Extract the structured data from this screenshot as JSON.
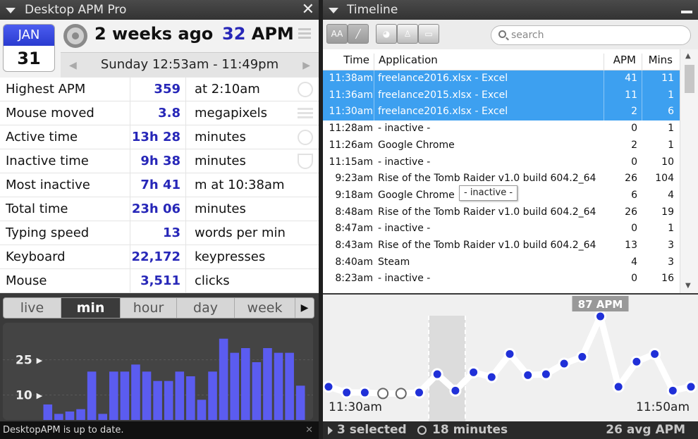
{
  "left_panel": {
    "title": "Desktop APM Pro",
    "close_label": "✕",
    "calendar": {
      "month": "JAN",
      "day": "31"
    },
    "ago": "2 weeks ago",
    "apm_value": "32",
    "apm_unit": "APM",
    "date_range": "Sunday 12:53am - 11:49pm",
    "stats": [
      {
        "label": "Highest APM",
        "value": "359",
        "unit": "at 2:10am"
      },
      {
        "label": "Mouse moved",
        "value": "3.8",
        "unit": "megapixels"
      },
      {
        "label": "Active time",
        "value": "13h 28",
        "unit": "minutes"
      },
      {
        "label": "Inactive time",
        "value": "9h 38",
        "unit": "minutes"
      },
      {
        "label": "Most inactive",
        "value": "7h 41",
        "unit": "m at 10:38am"
      },
      {
        "label": "Total time",
        "value": "23h 06",
        "unit": "minutes"
      },
      {
        "label": "Typing speed",
        "value": "13",
        "unit": "words per min"
      },
      {
        "label": "Keyboard",
        "value": "22,172",
        "unit": "keypresses"
      },
      {
        "label": "Mouse",
        "value": "3,511",
        "unit": "clicks"
      }
    ],
    "tabs": [
      "live",
      "min",
      "hour",
      "day",
      "week"
    ],
    "active_tab": "min",
    "status": "DesktopAPM is up to date.",
    "status_close": "✕"
  },
  "chart_data": {
    "type": "bar",
    "ytick_labels": [
      "25",
      "10"
    ],
    "ytick_values": [
      25,
      10
    ],
    "ylim": [
      0,
      36
    ],
    "values": [
      6,
      2,
      3,
      4,
      20,
      2,
      20,
      20,
      23,
      20,
      16,
      16,
      20,
      18,
      8,
      20,
      34,
      28,
      30,
      24,
      30,
      28,
      28,
      14
    ],
    "bar_color": "#5b5cf0",
    "grid": true
  },
  "right_panel": {
    "title": "Timeline",
    "toolbar_buttons": [
      "font-size-icon",
      "graph-icon",
      "pie-icon",
      "users-icon",
      "drive-icon"
    ],
    "search_placeholder": "search",
    "columns": {
      "time": "Time",
      "application": "Application",
      "apm": "APM",
      "mins": "Mins"
    },
    "rows": [
      {
        "time": "11:38am",
        "app": "freelance2016.xlsx - Excel",
        "apm": "41",
        "mins": "11",
        "selected": true
      },
      {
        "time": "11:36am",
        "app": "freelance2015.xlsx - Excel",
        "apm": "11",
        "mins": "1",
        "selected": true
      },
      {
        "time": "11:30am",
        "app": "freelance2016.xlsx - Excel",
        "apm": "2",
        "mins": "6",
        "selected": true
      },
      {
        "time": "11:28am",
        "app": "- inactive -",
        "apm": "0",
        "mins": "1",
        "selected": false
      },
      {
        "time": "11:26am",
        "app": "Google Chrome",
        "apm": "2",
        "mins": "1",
        "selected": false
      },
      {
        "time": "11:15am",
        "app": "- inactive -",
        "apm": "0",
        "mins": "10",
        "selected": false
      },
      {
        "time": "9:23am",
        "app": "Rise of the Tomb Raider v1.0 build 604.2_64",
        "apm": "26",
        "mins": "104",
        "selected": false
      },
      {
        "time": "9:18am",
        "app": "Google Chrome",
        "apm": "6",
        "mins": "4",
        "selected": false
      },
      {
        "time": "8:48am",
        "app": "Rise of the Tomb Raider v1.0 build 604.2_64",
        "apm": "26",
        "mins": "19",
        "selected": false
      },
      {
        "time": "8:47am",
        "app": "- inactive -",
        "apm": "0",
        "mins": "1",
        "selected": false
      },
      {
        "time": "8:43am",
        "app": "Rise of the Tomb Raider v1.0 build 604.2_64",
        "apm": "13",
        "mins": "3",
        "selected": false
      },
      {
        "time": "8:40am",
        "app": "Steam",
        "apm": "4",
        "mins": "3",
        "selected": false
      },
      {
        "time": "8:23am",
        "app": "- inactive -",
        "apm": "0",
        "mins": "16",
        "selected": false
      }
    ],
    "tooltip": "- inactive -",
    "timeline": {
      "peak_label": "87 APM",
      "start_label": "11:30am",
      "end_label": "11:50am",
      "values": [
        14,
        8,
        8,
        7,
        7,
        8,
        27,
        10,
        29,
        24,
        48,
        26,
        27,
        38,
        45,
        87,
        14,
        40,
        48,
        10,
        14
      ],
      "hollow_points": [
        3,
        4
      ],
      "ymax": 95
    },
    "status": {
      "selected": "3 selected",
      "duration": "18 minutes",
      "avg": "26 avg APM"
    }
  }
}
